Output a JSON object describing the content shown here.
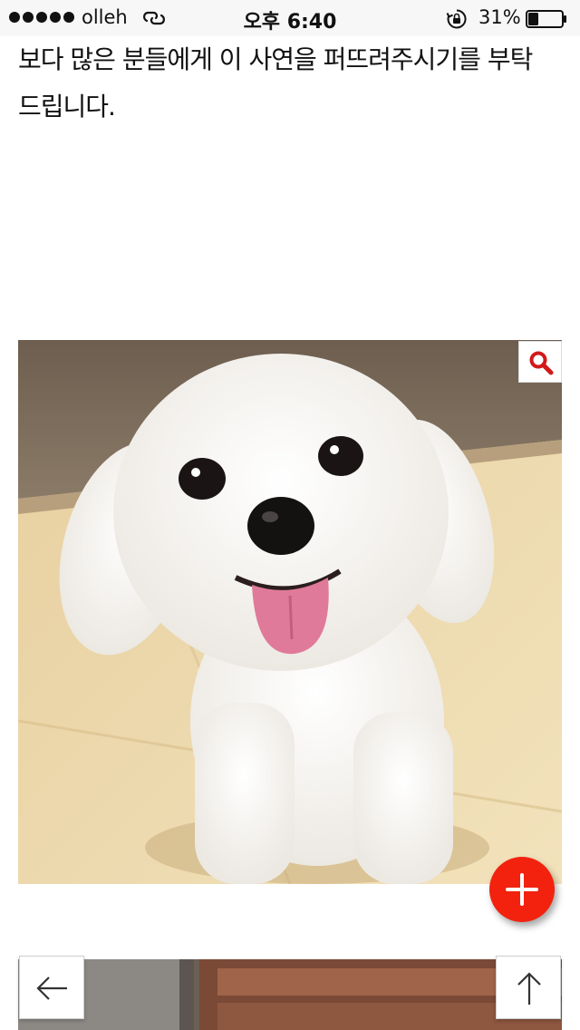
{
  "status_bar": {
    "carrier": "olleh",
    "time": "오후 6:40",
    "battery_percent": "31%",
    "battery_level": 0.31,
    "icons": [
      "signal-dots-icon",
      "link-icon",
      "rotation-lock-icon",
      "battery-icon"
    ]
  },
  "article": {
    "lines": [
      "보다 많은 분들에게 이 사연을 퍼뜨려주시기를 부탁",
      "드립니다."
    ]
  },
  "photo": {
    "subject": "white-dog-photo"
  },
  "buttons": {
    "zoom_icon": "magnifier-icon",
    "add_icon": "plus-icon",
    "back_icon": "arrow-left-icon",
    "top_icon": "arrow-up-icon"
  },
  "colors": {
    "fab": "#f2220f",
    "zoom_icon": "#d2191a",
    "status_bar_bg": "#f7f7f7"
  }
}
